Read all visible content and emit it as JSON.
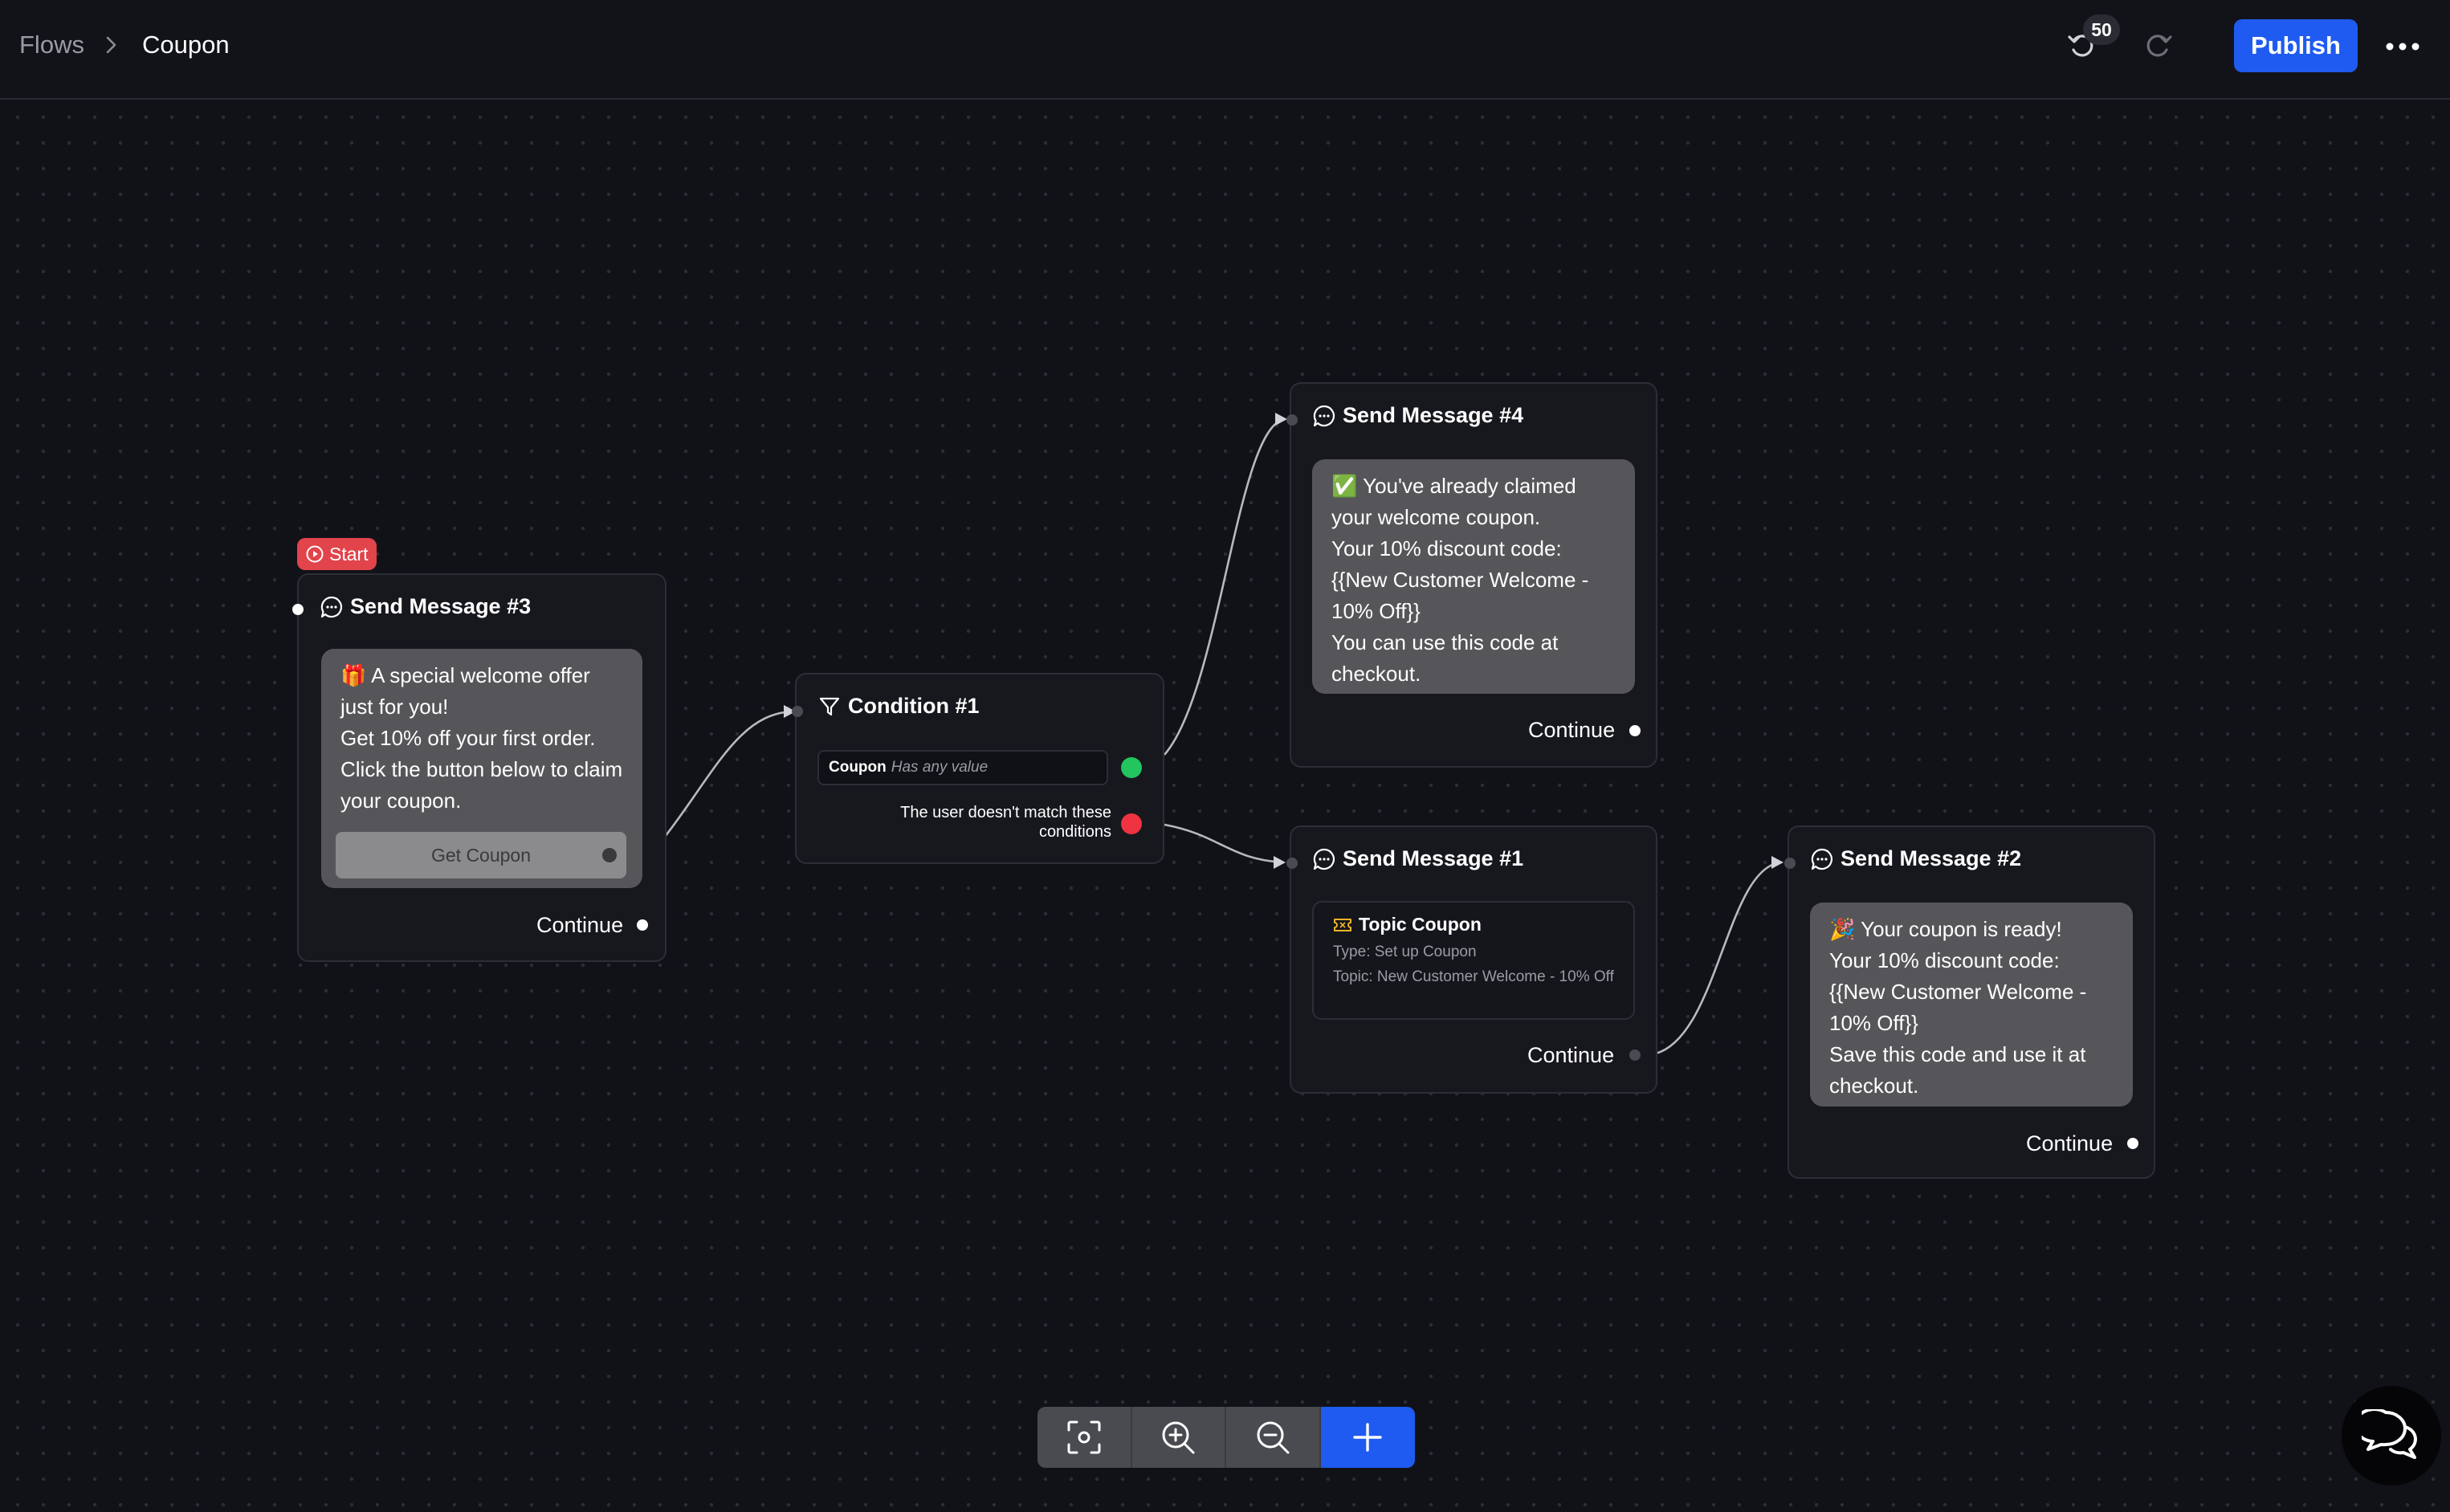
{
  "breadcrumb": {
    "root": "Flows",
    "current": "Coupon"
  },
  "toolbar_top": {
    "undo_count": "50",
    "publish_label": "Publish"
  },
  "nodes": {
    "send3": {
      "start_label": "Start",
      "title": "Send Message #3",
      "emoji": "🎁",
      "message": " A special welcome offer just for you!\nGet 10% off your first order.\nClick the button below to claim your coupon.",
      "button_label": "Get Coupon",
      "continue_label": "Continue"
    },
    "condition1": {
      "title": "Condition #1",
      "field": "Coupon",
      "operator": "Has any value",
      "else_label": "The user doesn't match these conditions"
    },
    "send4": {
      "title": "Send Message #4",
      "emoji": "✅",
      "message": " You've already claimed your welcome coupon.\nYour 10% discount code: {{New Customer Welcome - 10% Off}}\nYou can use this code at checkout.",
      "continue_label": "Continue"
    },
    "send1": {
      "title": "Send Message #1",
      "topic_title": "Topic Coupon",
      "type_line": "Type: Set up Coupon",
      "topic_line": "Topic: New Customer Welcome - 10% Off",
      "continue_label": "Continue"
    },
    "send2": {
      "title": "Send Message #2",
      "emoji": "🎉",
      "message": " Your coupon is ready!\nYour 10% discount code: {{New Customer Welcome - 10% Off}}\nSave this code and use it at checkout.",
      "continue_label": "Continue"
    }
  },
  "colors": {
    "accent": "#1f5bf0",
    "start": "#e1444b",
    "match": "#22c55e",
    "no_match": "#ef3340",
    "bubble": "#56565a",
    "node_bg": "#17181e"
  },
  "icons": {
    "undo": "undo-icon",
    "redo": "redo-icon",
    "more": "more-horizontal-icon",
    "message": "chat-bubble-icon",
    "filter": "filter-icon",
    "coupon": "ticket-icon",
    "fit_view": "focus-icon",
    "zoom_in": "zoom-in-icon",
    "zoom_out": "zoom-out-icon",
    "add": "plus-icon",
    "support": "chat-support-icon"
  }
}
